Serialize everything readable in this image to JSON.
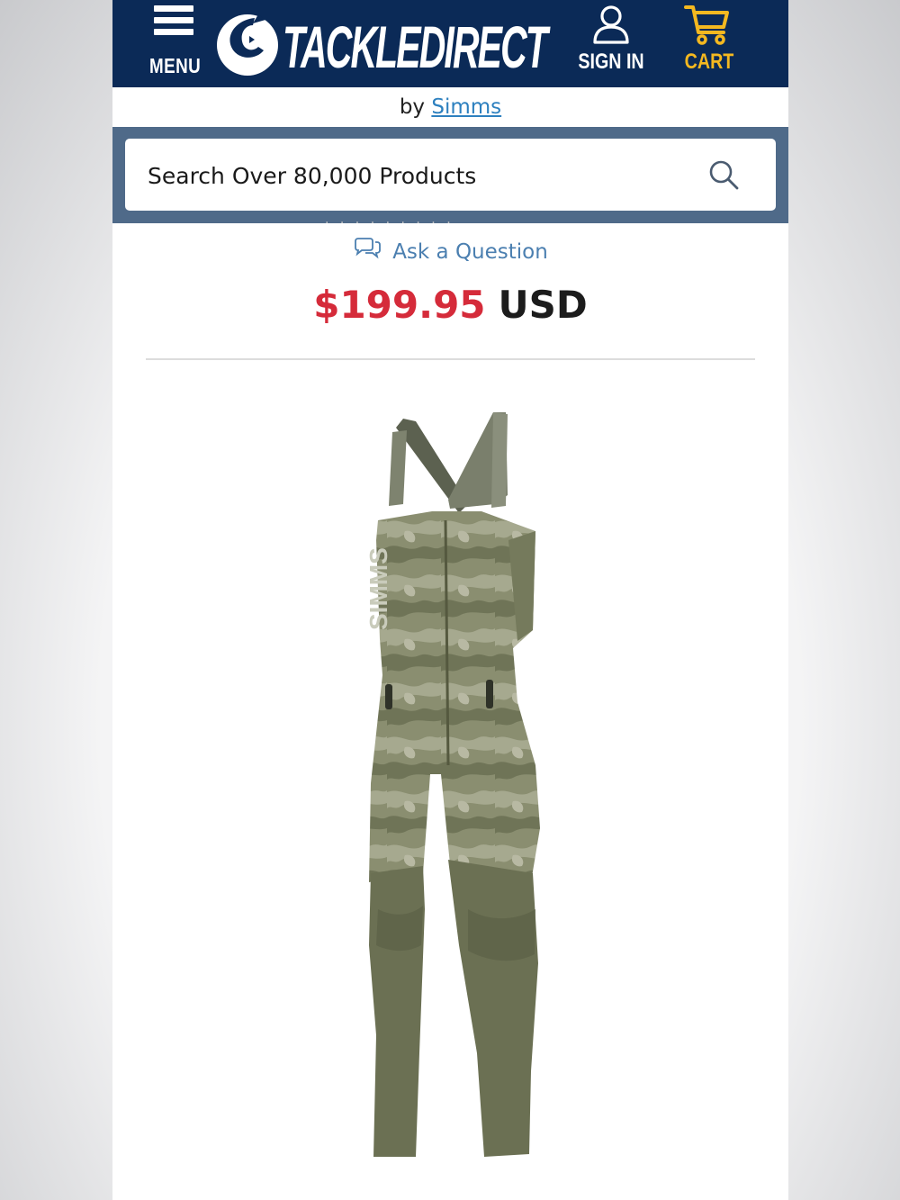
{
  "header": {
    "menu_label": "MENU",
    "brand": "TACKLEDIRECT",
    "sign_in_label": "SIGN IN",
    "cart_label": "CART",
    "bg_color": "#0b2a57",
    "cart_color": "#f4b820"
  },
  "byline": {
    "prefix": "by",
    "brand_link": "Simms"
  },
  "search": {
    "placeholder": "Search Over 80,000 Products"
  },
  "ask_question": {
    "label": "Ask a Question"
  },
  "price": {
    "amount": "$199.95",
    "currency": "USD",
    "amount_color": "#d52b3a"
  },
  "product_image": {
    "description_icon": "camo-bib-overalls-image",
    "wordmark": "SIMMS"
  }
}
